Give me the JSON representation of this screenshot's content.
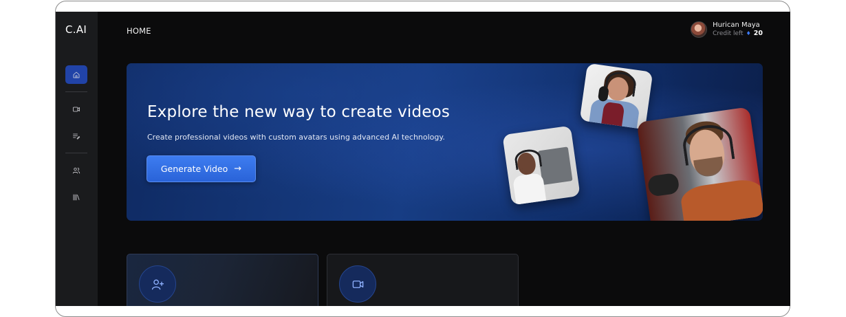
{
  "app": {
    "logo": "C.AI",
    "page_title": "HOME"
  },
  "user": {
    "name": "Hurican Maya",
    "credit_label": "Credit left",
    "credit_value": "20"
  },
  "sidebar": {
    "items": [
      {
        "name": "home",
        "icon": "home-icon",
        "active": true
      },
      {
        "name": "videos",
        "icon": "video-icon",
        "active": false
      },
      {
        "name": "scripts",
        "icon": "list-edit-icon",
        "active": false
      },
      {
        "name": "avatars",
        "icon": "users-icon",
        "active": false
      },
      {
        "name": "library",
        "icon": "library-icon",
        "active": false
      }
    ]
  },
  "hero": {
    "title": "Explore the new way to create videos",
    "subtitle": "Create professional videos with custom avatars using advanced AI technology.",
    "cta_label": "Generate Video",
    "cta_icon": "arrow-right-icon"
  },
  "cards": [
    {
      "icon": "user-plus-icon"
    },
    {
      "icon": "video-icon"
    }
  ],
  "colors": {
    "accent": "#2a63d8",
    "active_nav": "#2143a7",
    "background": "#0b0b0c",
    "sidebar": "#1a1b1d"
  }
}
